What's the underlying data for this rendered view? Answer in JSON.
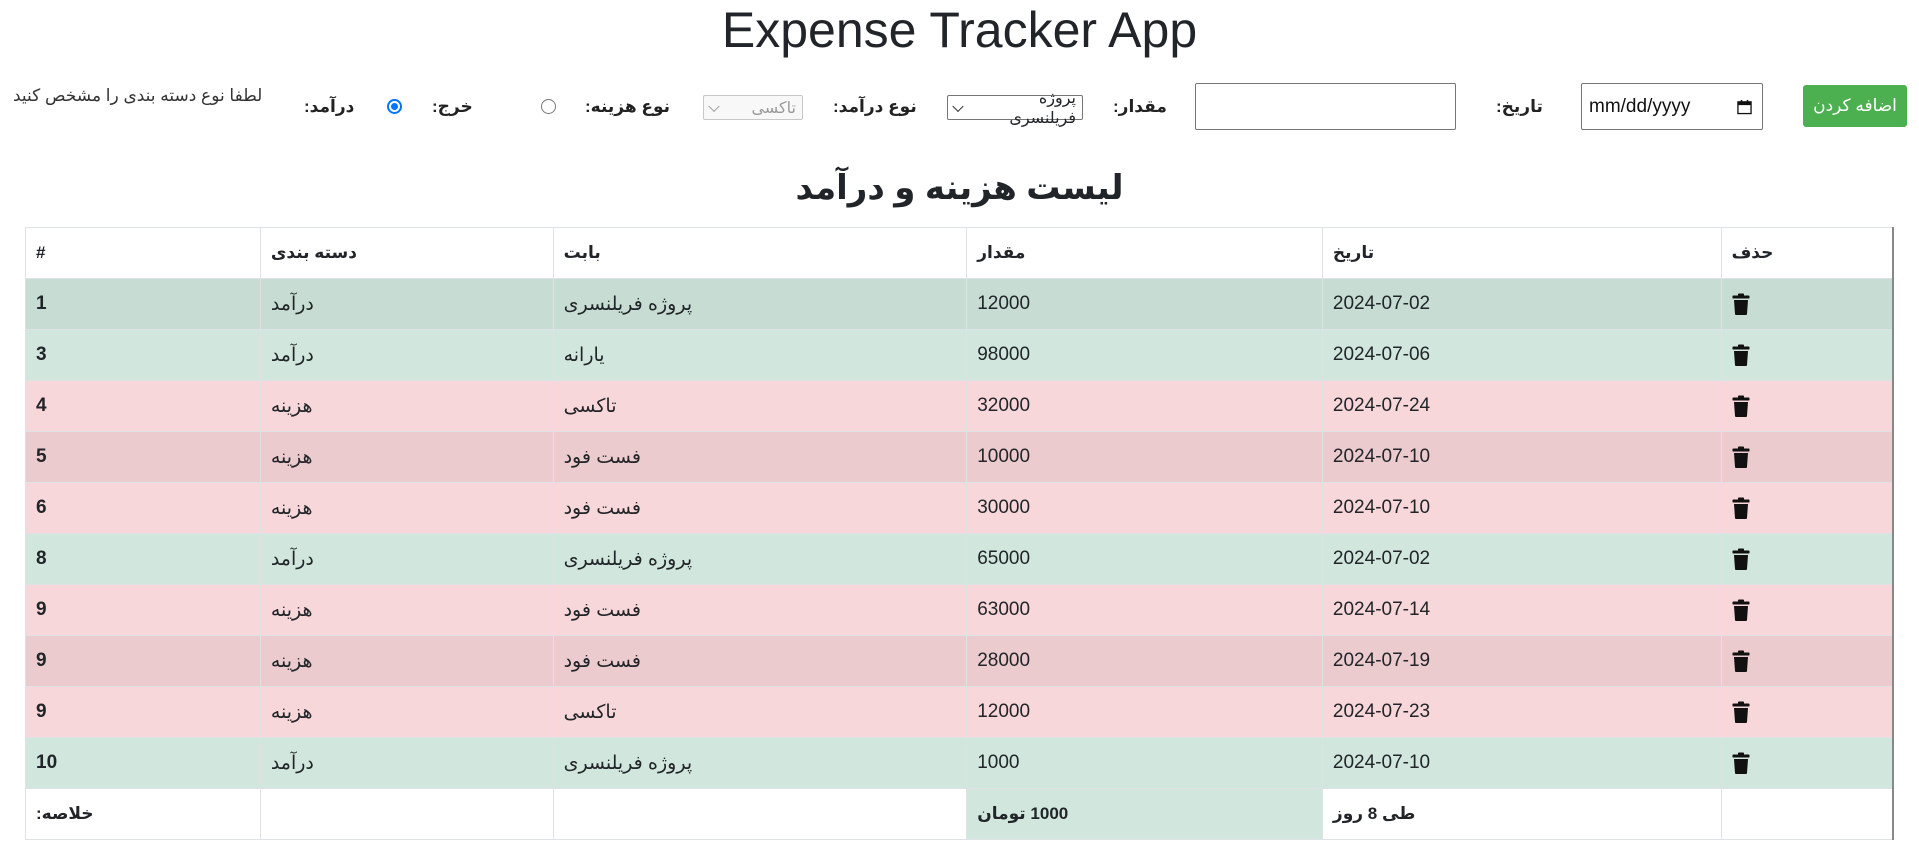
{
  "app": {
    "title": "Expense Tracker App"
  },
  "form": {
    "hint": "لطفا نوع دسته بندی را مشخص کنید",
    "income_label": "درآمد:",
    "income_checked": true,
    "expense_label": "خرج:",
    "expense_checked": false,
    "expense_type_label": "نوع هزینه:",
    "expense_type_value": "تاکسی",
    "income_type_label": "نوع درآمد:",
    "income_type_value": "پروژه فریلنسری",
    "amount_label": "مقدار:",
    "amount_value": "",
    "date_label": "تاریخ:",
    "date_placeholder": "mm/dd/yyyy",
    "add_button": "اضافه کردن"
  },
  "list": {
    "title": "لیست هزینه و درآمد",
    "columns": [
      "#",
      "دسته بندی",
      "بابت",
      "مقدار",
      "تاریخ",
      "حذف"
    ],
    "rows": [
      {
        "id": "1",
        "category": "درآمد",
        "subject": "پروژه فریلنسری",
        "amount": "12000",
        "date": "2024-07-02",
        "kind": "income"
      },
      {
        "id": "3",
        "category": "درآمد",
        "subject": "یارانه",
        "amount": "98000",
        "date": "2024-07-06",
        "kind": "income"
      },
      {
        "id": "4",
        "category": "هزینه",
        "subject": "تاکسی",
        "amount": "32000",
        "date": "2024-07-24",
        "kind": "expense"
      },
      {
        "id": "5",
        "category": "هزینه",
        "subject": "فست فود",
        "amount": "10000",
        "date": "2024-07-10",
        "kind": "expense"
      },
      {
        "id": "6",
        "category": "هزینه",
        "subject": "فست فود",
        "amount": "30000",
        "date": "2024-07-10",
        "kind": "expense"
      },
      {
        "id": "8",
        "category": "درآمد",
        "subject": "پروژه فریلنسری",
        "amount": "65000",
        "date": "2024-07-02",
        "kind": "income"
      },
      {
        "id": "9",
        "category": "هزینه",
        "subject": "فست فود",
        "amount": "63000",
        "date": "2024-07-14",
        "kind": "expense"
      },
      {
        "id": "9",
        "category": "هزینه",
        "subject": "فست فود",
        "amount": "28000",
        "date": "2024-07-19",
        "kind": "expense"
      },
      {
        "id": "9",
        "category": "هزینه",
        "subject": "تاکسی",
        "amount": "12000",
        "date": "2024-07-23",
        "kind": "expense"
      },
      {
        "id": "10",
        "category": "درآمد",
        "subject": "پروژه فریلنسری",
        "amount": "1000",
        "date": "2024-07-10",
        "kind": "income"
      }
    ],
    "summary": {
      "label": "خلاصه:",
      "total": "1000 تومان",
      "period": "طی 8 روز"
    }
  },
  "colors": {
    "income_row": "#d1e7dd",
    "expense_row": "#f8d7da",
    "add_button": "#4caf50",
    "radio_checked": "#0075ff"
  },
  "icons": {
    "delete": "trash-icon",
    "date_picker": "calendar-icon"
  }
}
